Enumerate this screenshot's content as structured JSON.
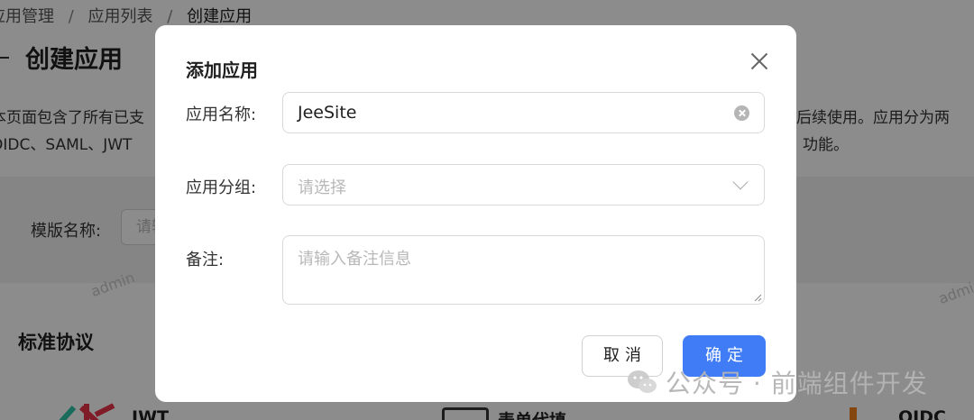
{
  "background": {
    "breadcrumb": [
      "应用管理",
      "应用列表",
      "创建应用"
    ],
    "page_title": "创建应用",
    "description_line1": "本页面包含了所有已支",
    "description_line2": "OIDC、SAML、JWT",
    "description_right1": "后续使用。应用分为两",
    "description_right2": "功能。",
    "filter_label": "模版名称:",
    "filter_placeholder": "请输入",
    "watermark_text": "admin",
    "section_title": "标准协议",
    "cards": [
      "JWT",
      "表单代填",
      "OIDC"
    ]
  },
  "modal": {
    "title": "添加应用",
    "name_label": "应用名称:",
    "name_value": "JeeSite",
    "group_label": "应用分组:",
    "group_placeholder": "请选择",
    "remark_label": "备注:",
    "remark_placeholder": "请输入备注信息",
    "cancel_label": "取消",
    "ok_label": "确定"
  },
  "channel_watermark": "公众号 · 前端组件开发",
  "colors": {
    "primary": "#3f7cf5",
    "mask": "rgba(0,0,0,0.45)",
    "jwt_red": "#e8344a",
    "jwt_green": "#2ec3a7",
    "oidc_orange": "#f0821e"
  },
  "icons": [
    "close-icon",
    "clear-icon",
    "chevron-down-icon",
    "resize-handle-icon",
    "wechat-icon",
    "back-arrow-icon"
  ]
}
